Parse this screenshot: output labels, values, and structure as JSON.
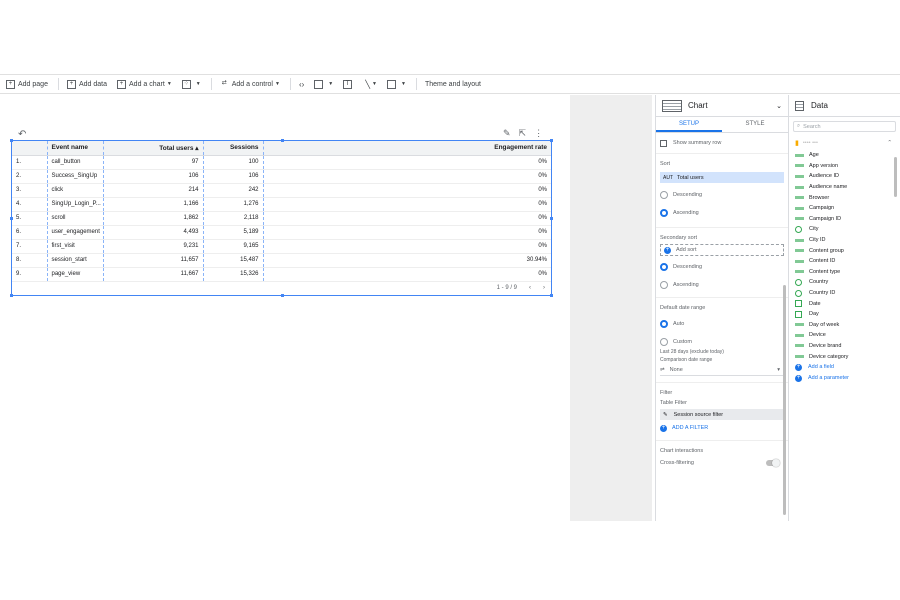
{
  "toolbar": {
    "add_page": "Add page",
    "add_data": "Add data",
    "add_chart": "Add a chart",
    "add_control": "Add a control",
    "theme": "Theme and layout"
  },
  "table": {
    "headers": [
      "",
      "Event name",
      "Total users ▴",
      "Sessions",
      "Engagement rate"
    ],
    "rows": [
      [
        "1.",
        "call_button",
        "97",
        "100",
        "0%"
      ],
      [
        "2.",
        "Success_SingUp",
        "106",
        "106",
        "0%"
      ],
      [
        "3.",
        "click",
        "214",
        "242",
        "0%"
      ],
      [
        "4.",
        "SingUp_Login_P...",
        "1,166",
        "1,276",
        "0%"
      ],
      [
        "5.",
        "scroll",
        "1,862",
        "2,118",
        "0%"
      ],
      [
        "6.",
        "user_engagement",
        "4,493",
        "5,189",
        "0%"
      ],
      [
        "7.",
        "first_visit",
        "9,231",
        "9,165",
        "0%"
      ],
      [
        "8.",
        "session_start",
        "11,657",
        "15,487",
        "30.94%"
      ],
      [
        "9.",
        "page_view",
        "11,667",
        "15,326",
        "0%"
      ]
    ],
    "pagination": "1 - 9 / 9"
  },
  "chart_panel": {
    "title": "Chart",
    "tab_setup": "SETUP",
    "tab_style": "STYLE",
    "show_summary": "Show summary row",
    "sort_label": "Sort",
    "sort_field_prefix": "AUT",
    "sort_field": "Total users",
    "descending": "Descending",
    "ascending": "Ascending",
    "secondary_sort": "Secondary sort",
    "add_sort": "Add sort",
    "default_date_range": "Default date range",
    "auto": "Auto",
    "custom": "Custom",
    "last_28": "Last 28 days (exclude today)",
    "comparison": "Comparison date range",
    "none": "None",
    "filter": "Filter",
    "table_filter": "Table Filter",
    "filter_chip": "Session source filter",
    "add_filter": "ADD A FILTER",
    "chart_interactions": "Chart interactions",
    "cross_filtering": "Cross-filtering"
  },
  "data_panel": {
    "title": "Data",
    "search_placeholder": "Search",
    "source_name": "•••• •••",
    "fields": [
      "Age",
      "App version",
      "Audience ID",
      "Audience name",
      "Browser",
      "Campaign",
      "Campaign ID",
      "City",
      "City ID",
      "Content group",
      "Content ID",
      "Content type",
      "Country",
      "Country ID",
      "Date",
      "Day",
      "Day of week",
      "Device",
      "Device brand",
      "Device category"
    ],
    "field_types": [
      "t",
      "t",
      "t",
      "t",
      "t",
      "t",
      "t",
      "g",
      "t",
      "t",
      "t",
      "t",
      "g",
      "g",
      "c",
      "c",
      "t",
      "t",
      "t",
      "t"
    ],
    "add_field": "Add a field",
    "add_parameter": "Add a parameter"
  }
}
